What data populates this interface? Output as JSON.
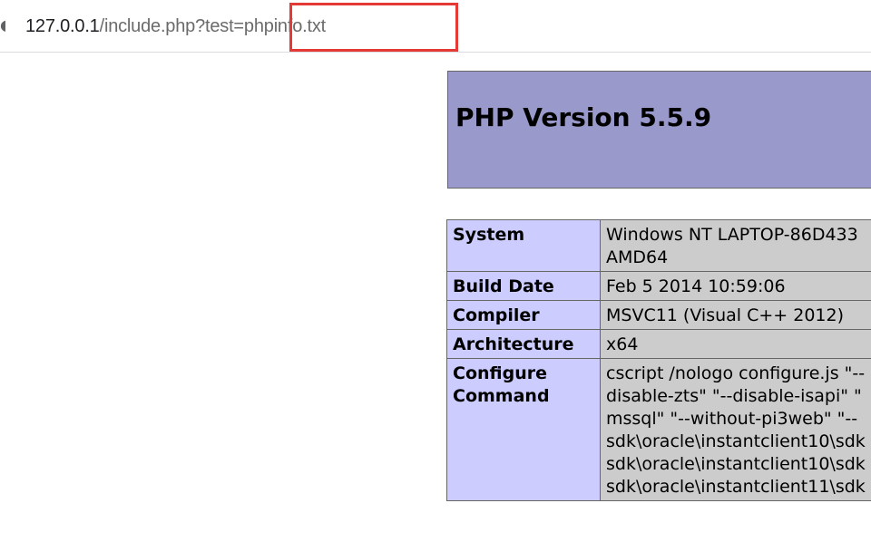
{
  "address_bar": {
    "host": "127.0.0.1",
    "path": "/include.php?test=",
    "param_value": "phpinfo.txt"
  },
  "header": {
    "title": "PHP Version 5.5.9"
  },
  "rows": [
    {
      "label": "System",
      "value_lines": [
        "Windows NT LAPTOP-86D433",
        "AMD64"
      ]
    },
    {
      "label": "Build Date",
      "value_lines": [
        "Feb 5 2014 10:59:06"
      ]
    },
    {
      "label": "Compiler",
      "value_lines": [
        "MSVC11 (Visual C++ 2012)"
      ]
    },
    {
      "label": "Architecture",
      "value_lines": [
        "x64"
      ]
    },
    {
      "label": "Configure Command",
      "value_lines": [
        "cscript /nologo configure.js \"--",
        "disable-zts\" \"--disable-isapi\" \"",
        "mssql\" \"--without-pi3web\" \"--",
        "sdk\\oracle\\instantclient10\\sdk",
        "sdk\\oracle\\instantclient10\\sdk",
        "sdk\\oracle\\instantclient11\\sdk"
      ]
    }
  ]
}
